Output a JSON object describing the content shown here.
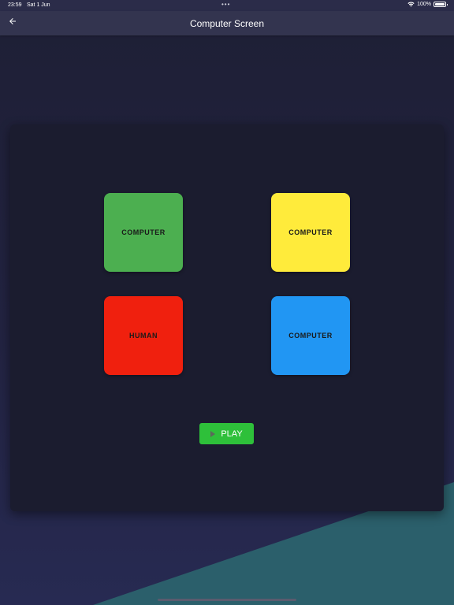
{
  "status_bar": {
    "time": "23:59",
    "date": "Sat 1 Jun",
    "dots": "•••",
    "battery_text": "100%",
    "wifi_icon": "wifi-icon",
    "battery_icon": "battery-icon",
    "battery_level": 1.0
  },
  "nav": {
    "back_icon": "arrow-left-icon",
    "title": "Computer Screen"
  },
  "players": [
    {
      "label": "COMPUTER",
      "color": "#4caf50"
    },
    {
      "label": "COMPUTER",
      "color": "#ffeb3b"
    },
    {
      "label": "HUMAN",
      "color": "#f0200e"
    },
    {
      "label": "COMPUTER",
      "color": "#2196f3"
    }
  ],
  "play_button": {
    "icon": "play-icon",
    "label": "PLAY",
    "color": "#2ec03a"
  },
  "colors": {
    "background": "#23243f",
    "nav_bar": "#33344f",
    "card": "#1b1c2f",
    "teal_accent": "#2b5f6b"
  }
}
